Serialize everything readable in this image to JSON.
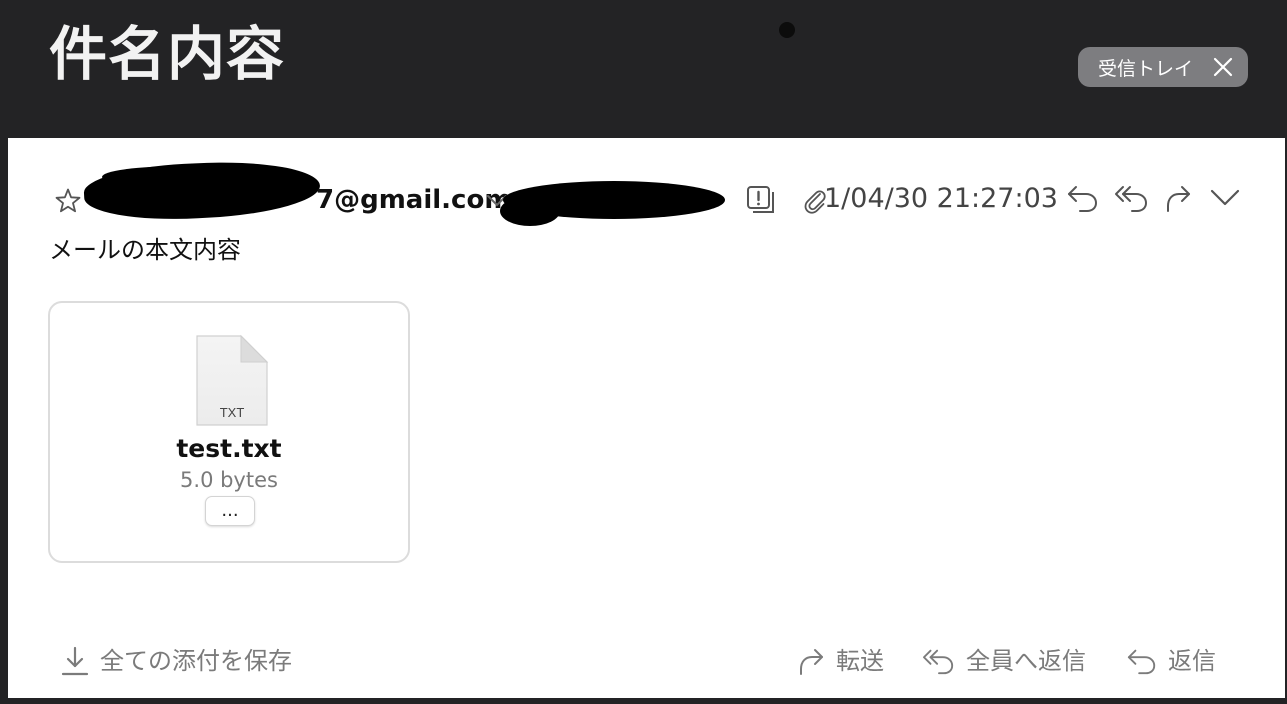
{
  "header": {
    "subject": "件名内容",
    "mailbox_badge": "受信トレイ"
  },
  "message": {
    "sender_visible": "7@gmail.com",
    "date": "1/04/30 21:27:03",
    "body": "メールの本文内容"
  },
  "attachment": {
    "type_label": "TXT",
    "name": "test.txt",
    "size": "5.0 bytes",
    "more_label": "..."
  },
  "footer": {
    "save_all": "全ての添付を保存",
    "forward": "転送",
    "reply_all": "全員へ返信",
    "reply": "返信"
  },
  "icons": {
    "star": "star-icon",
    "chevron": "chevron-down-icon",
    "read_status": "message-status-icon",
    "attachment": "paperclip-icon",
    "reply": "reply-icon",
    "reply_all": "reply-all-icon",
    "forward": "forward-icon",
    "more": "chevron-down-icon",
    "close": "close-icon",
    "download": "download-icon"
  },
  "colors": {
    "header_bg": "#232325",
    "badge_bg": "#7d7d80",
    "panel_bg": "#ffffff",
    "footer_text": "#7b7b7b"
  }
}
